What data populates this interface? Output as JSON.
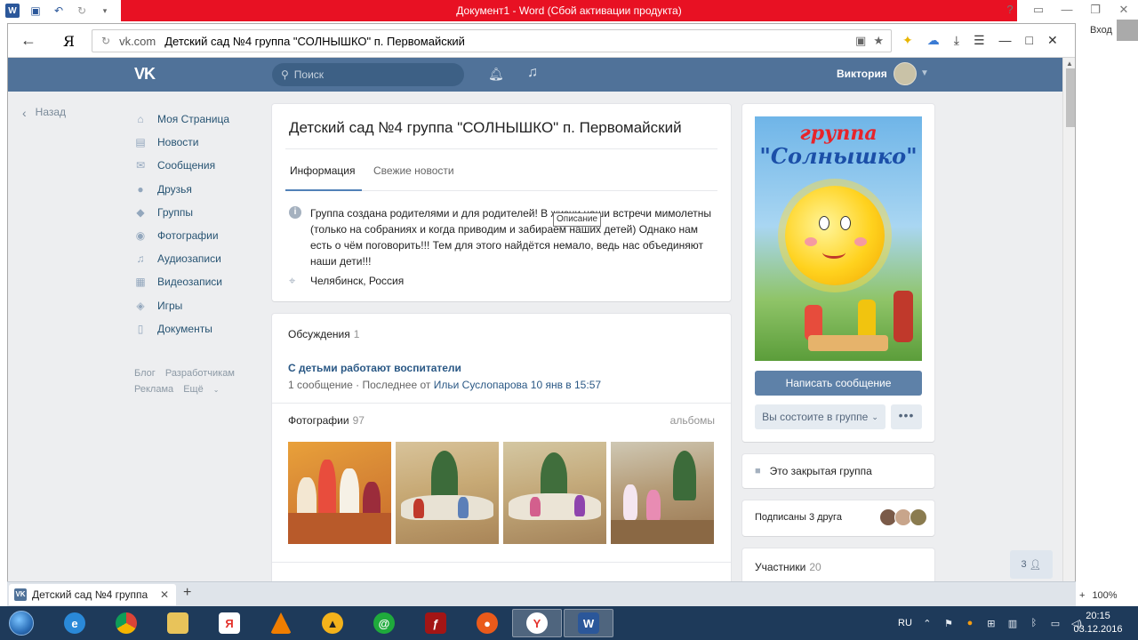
{
  "word": {
    "title": "Документ1 - Word (Сбой активации продукта)",
    "login_label": "Вход",
    "window_controls": [
      "?",
      "▭",
      "—",
      "❐",
      "✕"
    ]
  },
  "browser": {
    "url_host": "vk.com",
    "url_title": "Детский сад №4 группа \"СОЛНЫШКО\" п. Первомайский",
    "search_engine_logo": "Я",
    "tab_title": "Детский сад №4 группа",
    "zoom_level": "100%"
  },
  "vk": {
    "logo": "VK",
    "search_placeholder": "Поиск",
    "user_name": "Виктория",
    "back_label": "Назад",
    "nav": [
      {
        "label": "Моя Страница",
        "icon": "home-icon",
        "glyph": "⌂"
      },
      {
        "label": "Новости",
        "icon": "news-icon",
        "glyph": "▤"
      },
      {
        "label": "Сообщения",
        "icon": "messages-icon",
        "glyph": "✉"
      },
      {
        "label": "Друзья",
        "icon": "friends-icon",
        "glyph": "●"
      },
      {
        "label": "Группы",
        "icon": "groups-icon",
        "glyph": "◆"
      },
      {
        "label": "Фотографии",
        "icon": "camera-icon",
        "glyph": "◉"
      },
      {
        "label": "Аудиозаписи",
        "icon": "music-icon",
        "glyph": "♫"
      },
      {
        "label": "Видеозаписи",
        "icon": "video-icon",
        "glyph": "▦"
      },
      {
        "label": "Игры",
        "icon": "games-icon",
        "glyph": "◈"
      },
      {
        "label": "Документы",
        "icon": "documents-icon",
        "glyph": "▯"
      }
    ],
    "footer": {
      "blog": "Блог",
      "developers": "Разработчикам",
      "ads": "Реклама",
      "more": "Ещё"
    }
  },
  "group": {
    "title": "Детский сад №4 группа \"СОЛНЫШКО\" п. Первомайский",
    "tabs": [
      "Информация",
      "Свежие новости"
    ],
    "description": "Группа создана родителями и для родителей! В жизни наши встречи мимолетны (только на собраниях и когда приводим и забираем наших детей) Однако нам есть о чём поговорить!!! Тем для этого найдётся немало, ведь нас объединяют наши дети!!!",
    "tooltip": "Описание",
    "location": "Челябинск, Россия",
    "discussions": {
      "title": "Обсуждения",
      "count": "1",
      "topic": "С детьми работают воспитатели",
      "messages": "1 сообщение",
      "last_prefix": "· Последнее от",
      "last_author": "Ильи Суслопарова",
      "last_time": "10 янв в 15:57"
    },
    "photos": {
      "title": "Фотографии",
      "count": "97",
      "albums_link": "альбомы"
    },
    "avatar": {
      "line1": "группа",
      "line2": "\"Солнышко\""
    },
    "write_message": "Написать сообщение",
    "membership": "Вы состоите в группе",
    "more_button": "•••",
    "closed_group": "Это закрытая группа",
    "friends_subscribed": "Подписаны 3 друга",
    "members_label": "Участники",
    "members_count": "20",
    "chat_count": "3"
  },
  "taskbar": {
    "language": "RU",
    "time": "20:15",
    "date": "03.12.2016"
  },
  "colors": {
    "vk_header": "#507299",
    "vk_link": "#2a5885",
    "word_red": "#e81123",
    "taskbar": "#1e3a5a"
  }
}
